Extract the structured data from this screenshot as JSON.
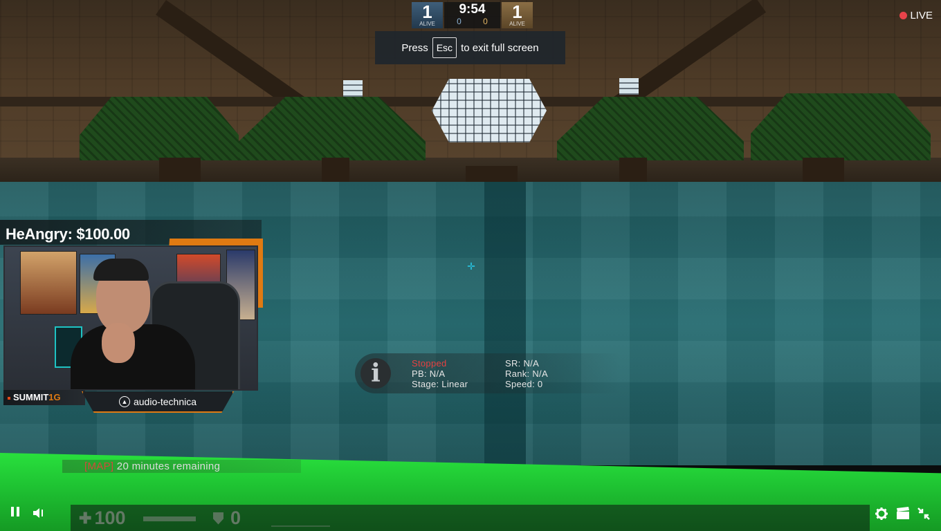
{
  "scoreboard": {
    "ct_alive": "1",
    "ct_alive_label": "ALIVE",
    "t_alive": "1",
    "t_alive_label": "ALIVE",
    "clock": "9:54",
    "ct_rounds": "0",
    "t_rounds": "0"
  },
  "fullscreen_notice": {
    "prefix": "Press",
    "key": "Esc",
    "suffix": "to exit full screen"
  },
  "live": {
    "label": "LIVE",
    "color": "#e8434a"
  },
  "donation": {
    "text": "HeAngry: $100.00"
  },
  "streamer": {
    "name_main": "SUMMIT",
    "name_accent": "1G",
    "accent_color": "#e07a12"
  },
  "sponsor": {
    "logo_icon": "audio-technica-logo-icon",
    "text": "audio-technica"
  },
  "timer_panel": {
    "icon": "info-icon",
    "status": "Stopped",
    "status_color": "#e64141",
    "pb": "PB: N/A",
    "stage": "Stage: Linear",
    "sr": "SR: N/A",
    "rank": "Rank: N/A",
    "speed": "Speed: 0"
  },
  "map_notice": {
    "tag": "[MAP]",
    "text": " 20 minutes remaining"
  },
  "hud": {
    "health": "100",
    "armor": "0"
  },
  "controls": {
    "pause_icon": "pause-icon",
    "volume_icon": "volume-icon",
    "settings_icon": "gear-icon",
    "theatre_icon": "theatre-mode-icon",
    "exit_fullscreen_icon": "exit-fullscreen-icon"
  }
}
